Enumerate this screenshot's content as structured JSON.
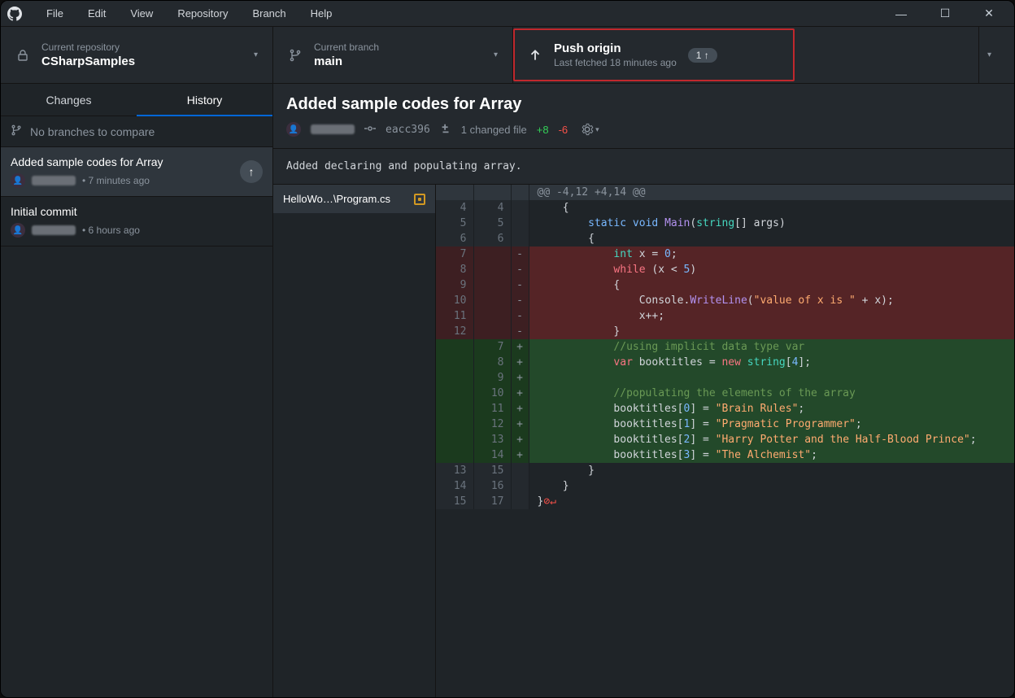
{
  "menus": [
    "File",
    "Edit",
    "View",
    "Repository",
    "Branch",
    "Help"
  ],
  "toolbar": {
    "repo": {
      "label": "Current repository",
      "value": "CSharpSamples"
    },
    "branch": {
      "label": "Current branch",
      "value": "main"
    },
    "push": {
      "title": "Push origin",
      "sub": "Last fetched 18 minutes ago",
      "badge": "1 ↑"
    }
  },
  "tabs": {
    "changes": "Changes",
    "history": "History"
  },
  "compare": "No branches to compare",
  "commits": [
    {
      "title": "Added sample codes for Array",
      "time": "7 minutes ago",
      "sel": true,
      "pending": true
    },
    {
      "title": "Initial commit",
      "time": "6 hours ago"
    }
  ],
  "detail": {
    "title": "Added sample codes for Array",
    "sha": "eacc396",
    "files": "1 changed file",
    "plus": "+8",
    "minus": "-6",
    "desc": "Added declaring and populating array.",
    "file": "HelloWo…\\Program.cs"
  },
  "diff": [
    {
      "t": "hunk",
      "a": "",
      "b": "",
      "txt": "@@ -4,12 +4,14 @@"
    },
    {
      "t": "ctx",
      "a": "4",
      "b": "4",
      "txt": "    {"
    },
    {
      "t": "ctx",
      "a": "5",
      "b": "5",
      "html": "        <span class='k-blue'>static</span> <span class='k-blue'>void</span> <span class='k-id'>Main</span>(<span class='k-teal'>string</span>[] args)"
    },
    {
      "t": "ctx",
      "a": "6",
      "b": "6",
      "txt": "        {"
    },
    {
      "t": "del",
      "a": "7",
      "b": "",
      "html": "            <span class='k-teal'>int</span> x = <span class='k-num'>0</span>;"
    },
    {
      "t": "del",
      "a": "8",
      "b": "",
      "html": "            <span class='k-red'>while</span> (x &lt; <span class='k-num'>5</span>)"
    },
    {
      "t": "del",
      "a": "9",
      "b": "",
      "txt": "            {"
    },
    {
      "t": "del",
      "a": "10",
      "b": "",
      "html": "                Console.<span class='k-id'>WriteLine</span>(<span class='k-str'>\"value of x is \"</span> + x);"
    },
    {
      "t": "del",
      "a": "11",
      "b": "",
      "txt": "                x++;"
    },
    {
      "t": "del",
      "a": "12",
      "b": "",
      "txt": "            }"
    },
    {
      "t": "add",
      "a": "",
      "b": "7",
      "html": "            <span class='k-cmt'>//using implicit data type var</span>"
    },
    {
      "t": "add",
      "a": "",
      "b": "8",
      "html": "            <span class='k-red'>var</span> booktitles = <span class='k-red'>new</span> <span class='k-teal'>string</span>[<span class='k-num'>4</span>];"
    },
    {
      "t": "add",
      "a": "",
      "b": "9",
      "txt": ""
    },
    {
      "t": "add",
      "a": "",
      "b": "10",
      "html": "            <span class='k-cmt'>//populating the elements of the array</span>"
    },
    {
      "t": "add",
      "a": "",
      "b": "11",
      "html": "            booktitles[<span class='k-num'>0</span>] = <span class='k-str'>\"Brain Rules\"</span>;"
    },
    {
      "t": "add",
      "a": "",
      "b": "12",
      "html": "            booktitles[<span class='k-num'>1</span>] = <span class='k-str'>\"Pragmatic Programmer\"</span>;"
    },
    {
      "t": "add",
      "a": "",
      "b": "13",
      "html": "            booktitles[<span class='k-num'>2</span>] = <span class='k-str'>\"Harry Potter and the Half-Blood Prince\"</span>;"
    },
    {
      "t": "add",
      "a": "",
      "b": "14",
      "html": "            booktitles[<span class='k-num'>3</span>] = <span class='k-str'>\"The Alchemist\"</span>;"
    },
    {
      "t": "ctx",
      "a": "13",
      "b": "15",
      "txt": "        }"
    },
    {
      "t": "ctx",
      "a": "14",
      "b": "16",
      "txt": "    }"
    },
    {
      "t": "ctx",
      "a": "15",
      "b": "17",
      "html": "}<span class='noeol'>⊘↵</span>"
    }
  ]
}
